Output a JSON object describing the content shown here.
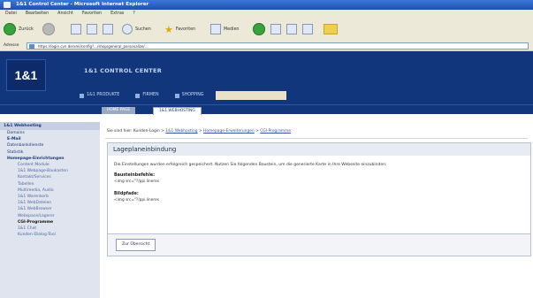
{
  "window": {
    "title": "1&1 Control Center - Microsoft Internet Explorer"
  },
  "menubar": [
    "Datei",
    "Bearbeiten",
    "Ansicht",
    "Favoriten",
    "Extras",
    "?"
  ],
  "toolbar": {
    "back_label": "Zurück",
    "search_label": "Suchen",
    "favorites_label": "Favoriten",
    "media_label": "Medien"
  },
  "address": {
    "label": "Adresse",
    "url": "https://login.cvn.de/xml/config?.../shop/general_personalize/..."
  },
  "header": {
    "logo_text": "1&1",
    "app_title": "1&1 CONTROL CENTER",
    "nav_tabs": [
      "1&1 PRODUKTE",
      "FIRMEN",
      "SHOPPING",
      ""
    ]
  },
  "subnav": {
    "tabs": [
      "HOME PAGE",
      "1&1 WEBHOSTING"
    ]
  },
  "sidebar": {
    "title": "1&1 Webhosting",
    "items": [
      {
        "label": "Domains",
        "level": 0
      },
      {
        "label": "E-Mail",
        "level": 0,
        "bold": true
      },
      {
        "label": "Datenbankdienste",
        "level": 0
      },
      {
        "label": "Statistik",
        "level": 0
      },
      {
        "label": "Homepage-Einrichtungen",
        "level": 0,
        "bold": true
      },
      {
        "label": "Content Module",
        "level": 1
      },
      {
        "label": "1&1 Webpage-Baukasten",
        "level": 1
      },
      {
        "label": "Kontakt/Services",
        "level": 1
      },
      {
        "label": "Tabellen",
        "level": 1
      },
      {
        "label": "Multimedia, Audio",
        "level": 1
      },
      {
        "label": "1&1 Warenkorb",
        "level": 1
      },
      {
        "label": "1&1 WebDateien",
        "level": 1
      },
      {
        "label": "1&1 WebBrowser",
        "level": 1
      },
      {
        "label": "Webspace/Lagerer",
        "level": 1
      },
      {
        "label": "CGI-Programme",
        "level": 1,
        "current": true
      },
      {
        "label": "1&1 Chat",
        "level": 1
      },
      {
        "label": "Kunden-Dialog-Tool",
        "level": 1
      }
    ]
  },
  "breadcrumb": {
    "prefix": "Sie sind hier: Kunden-Login >",
    "links": [
      "1&1 Webhosting",
      "Homepage-Erweiterungen",
      "CGI-Programme"
    ],
    "separator": ">"
  },
  "panel": {
    "title": "Lageplaneinbindung",
    "message": "Die Einstellungen wurden erfolgreich gespeichert. Nutzen Sie folgenden Baustein, um die generierte Karte in Ihre Webseite einzubinden:",
    "fields": [
      {
        "label": "Bausteinbefehle:",
        "value": "<img src=\"?/ppi.lineres"
      },
      {
        "label": "Bildpfade:",
        "value": "<img src=\"?/ppi.lineres"
      }
    ]
  },
  "footer_button": {
    "label": "Zur Übersicht"
  }
}
